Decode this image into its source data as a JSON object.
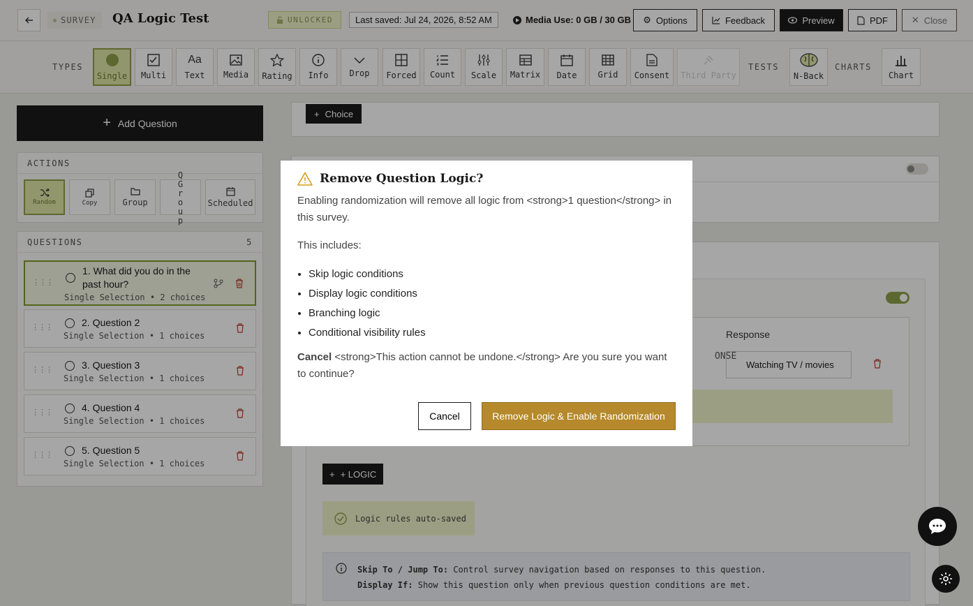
{
  "header": {
    "survey_badge": "SURVEY",
    "title": "QA Logic Test",
    "lock_status": "UNLOCKED",
    "last_saved": "Last saved: Jul 24, 2026, 8:52 AM",
    "media_use": "Media Use: 0 GB / 30 GB",
    "options": "Options",
    "feedback": "Feedback",
    "preview": "Preview",
    "pdf": "PDF",
    "close": "Close"
  },
  "types": {
    "label": "TYPES",
    "items": [
      "Single",
      "Multi",
      "Text",
      "Media",
      "Rating",
      "Info",
      "Drop",
      "Forced",
      "Count",
      "Scale",
      "Matrix",
      "Date",
      "Grid",
      "Consent",
      "Third Party"
    ],
    "tests_label": "TESTS",
    "nback": "N-Back",
    "charts_label": "CHARTS",
    "chart": "Chart"
  },
  "sidebar": {
    "add_question": "Add Question",
    "actions_label": "ACTIONS",
    "actions": [
      "Random",
      "Copy",
      "Group",
      "Q Group",
      "Scheduled"
    ],
    "questions_label": "QUESTIONS",
    "questions_count": "5",
    "questions": [
      {
        "title": "1. What did you do in the past hour?",
        "meta": "Single Selection • 2 choices"
      },
      {
        "title": "2. Question 2",
        "meta": "Single Selection • 1 choices"
      },
      {
        "title": "3. Question 3",
        "meta": "Single Selection • 1 choices"
      },
      {
        "title": "4. Question 4",
        "meta": "Single Selection • 1 choices"
      },
      {
        "title": "5. Question 5",
        "meta": "Single Selection • 1 choices"
      }
    ]
  },
  "main": {
    "choice_button": "Choice",
    "response_label": "Response",
    "response_value": "Watching TV / movies",
    "onse_fragment": "ONSE",
    "add_logic": "+ LOGIC",
    "autosaved": "Logic rules auto-saved",
    "info_skip_label": "Skip To / Jump To:",
    "info_skip_text": "Control survey navigation based on responses to this question.",
    "info_display_label": "Display If:",
    "info_display_text": "Show this question only when previous question conditions are met."
  },
  "modal": {
    "title": "Remove Question Logic?",
    "line1": "Enabling randomization will remove all logic from <strong>1 question</strong> in this survey.",
    "includes": "This includes:",
    "items": [
      "Skip logic conditions",
      "Display logic conditions",
      "Branching logic",
      "Conditional visibility rules"
    ],
    "warning_strong": "Cancel",
    "warning_text": " <strong>This action cannot be undone.</strong> Are you sure you want to continue?",
    "cancel": "Cancel",
    "confirm": "Remove Logic & Enable Randomization"
  },
  "colors": {
    "accent_green": "#8fa04a",
    "confirm_gold": "#b5892c",
    "danger": "#c0392b"
  }
}
